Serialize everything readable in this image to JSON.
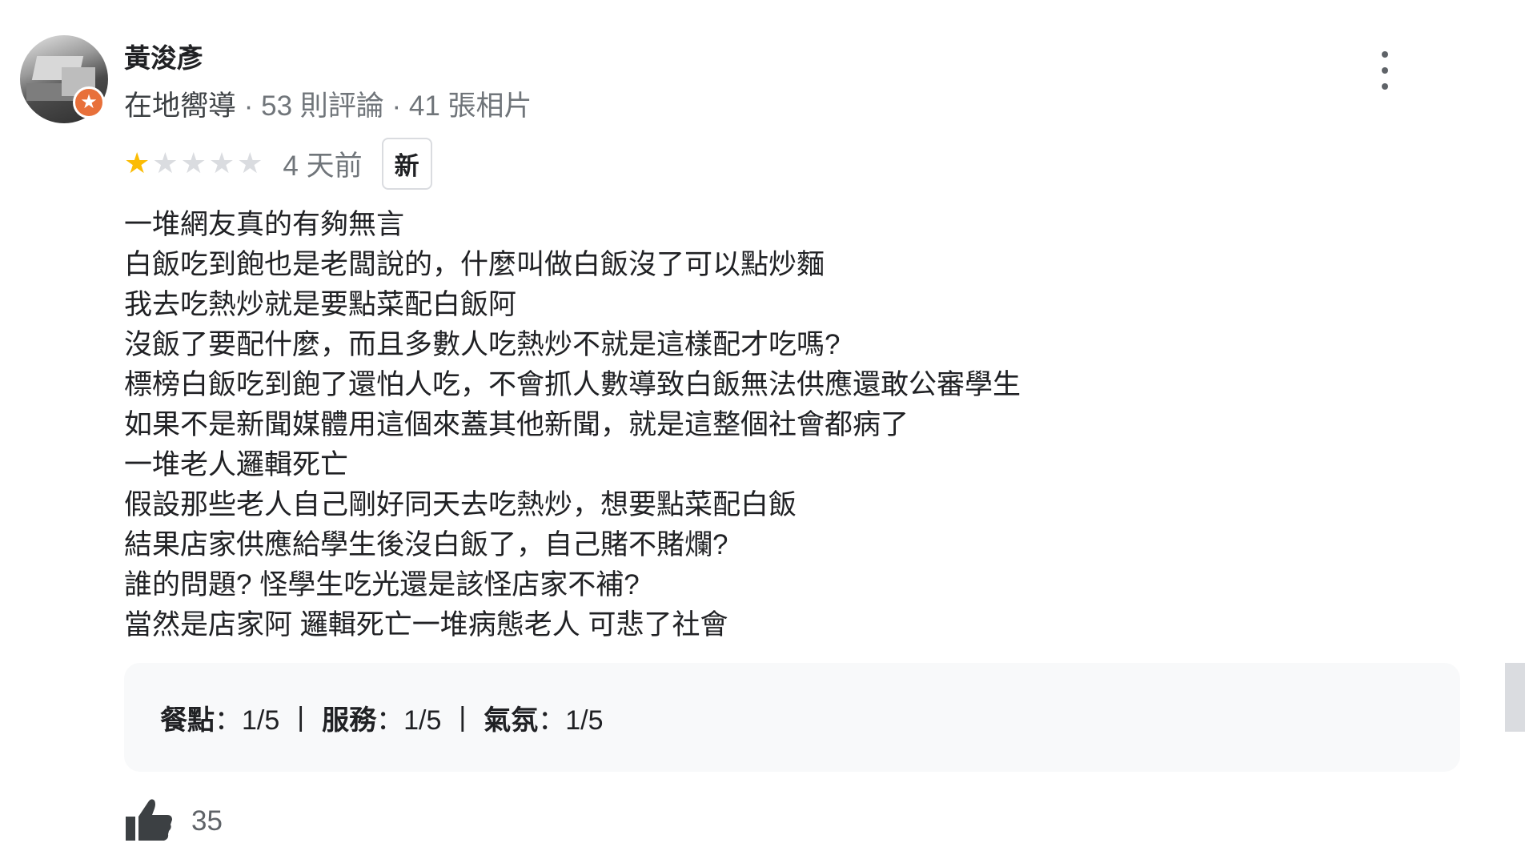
{
  "author": {
    "name": "黃浚彥",
    "level": "在地嚮導",
    "meta": " · 53 則評論 · 41 張相片"
  },
  "rating": {
    "stars": 1,
    "max_stars": 5,
    "time_ago": "4 天前",
    "badge": "新"
  },
  "review_lines": [
    "一堆網友真的有夠無言",
    "白飯吃到飽也是老闆說的，什麼叫做白飯沒了可以點炒麵",
    "我去吃熱炒就是要點菜配白飯阿",
    "沒飯了要配什麼，而且多數人吃熱炒不就是這樣配才吃嗎?",
    "標榜白飯吃到飽了還怕人吃，不會抓人數導致白飯無法供應還敢公審學生",
    "如果不是新聞媒體用這個來蓋其他新聞，就是這整個社會都病了",
    "一堆老人邏輯死亡",
    "假設那些老人自己剛好同天去吃熱炒，想要點菜配白飯",
    "結果店家供應給學生後沒白飯了，自己賭不賭爛?",
    "誰的問題? 怪學生吃光還是該怪店家不補?",
    "當然是店家阿 邏輯死亡一堆病態老人 可悲了社會"
  ],
  "subratings": [
    {
      "label": "餐點",
      "value": "：1/5"
    },
    {
      "label": "服務",
      "value": "：1/5"
    },
    {
      "label": "氣氛",
      "value": "：1/5"
    }
  ],
  "separator": "|",
  "likes": "35",
  "colors": {
    "star_full": "#fbbc04",
    "star_empty": "#dadce0",
    "guide_badge": "#e8703a"
  },
  "icons": {
    "more": "more-vert-icon",
    "like": "thumbs-up-icon",
    "guide": "local-guide-star-icon"
  }
}
